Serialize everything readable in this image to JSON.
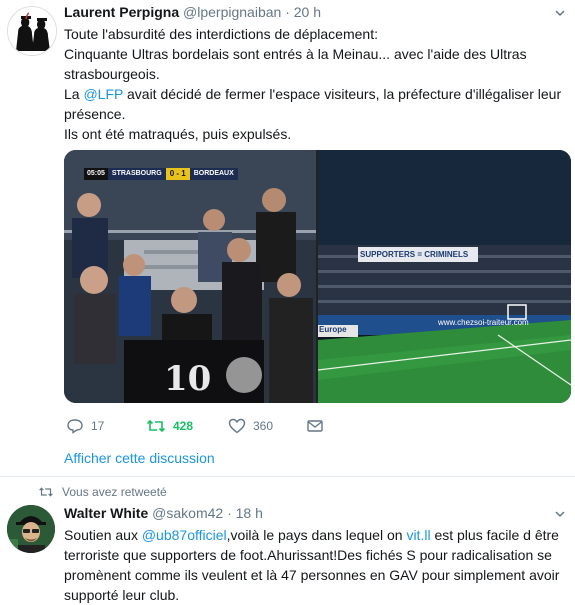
{
  "tweet1": {
    "name": "Laurent Perpigna",
    "handle": "@lperpignaiban",
    "separator": "·",
    "time": "20 h",
    "lines": {
      "l1": "Toute l'absurdité des interdictions de déplacement:",
      "l2": "Cinquante Ultras bordelais sont entrés à la Meinau... avec l'aide des Ultras",
      "l3": "strasbourgeois.",
      "l4_pre": "La ",
      "l4_mention": "@LFP",
      "l4_post": " avait décidé de fermer l'espace visiteurs, la préfecture d'illégaliser leur",
      "l5": "présence.",
      "l6": "Ils ont été matraqués, puis expulsés."
    },
    "media": {
      "score_clock": "05:05",
      "score_home": "STRASBOURG",
      "score_result": "0 - 1",
      "score_away": "BORDEAUX",
      "banner": "SUPPORTERS = CRIMINELS",
      "board_left": "Europe",
      "board_right": "www.chezsoi-traiteur.com"
    },
    "actions": {
      "reply_icon": "reply-icon",
      "reply_count": "17",
      "retweet_icon": "retweet-icon",
      "retweet_count": "428",
      "like_icon": "heart-icon",
      "like_count": "360",
      "dm_icon": "envelope-icon"
    },
    "show_thread": "Afficher cette discussion"
  },
  "tweet2": {
    "retweeted_by": "Vous avez retweeté",
    "name": "Walter White",
    "handle": "@sakom42",
    "separator": "·",
    "time": "18 h",
    "lines": {
      "l1_pre": "Soutien aux ",
      "l1_mention": "@ub87officiel",
      "l1_mid": ",voilà le pays dans lequel on ",
      "l1_link": "vit.ll",
      "l1_post": " est plus facile d être",
      "l2": "terroriste que  supporters de foot.Ahurissant!Des fichés S pour radicalisation se",
      "l3": "promènent comme ils veulent et là 47 personnes en GAV pour simplement avoir",
      "l4": "supporté leur club."
    }
  },
  "colors": {
    "text": "#14171a",
    "secondary": "#657786",
    "link": "#1b95e0",
    "retweet_active": "#17bf63",
    "divider": "#e6ecf0"
  }
}
